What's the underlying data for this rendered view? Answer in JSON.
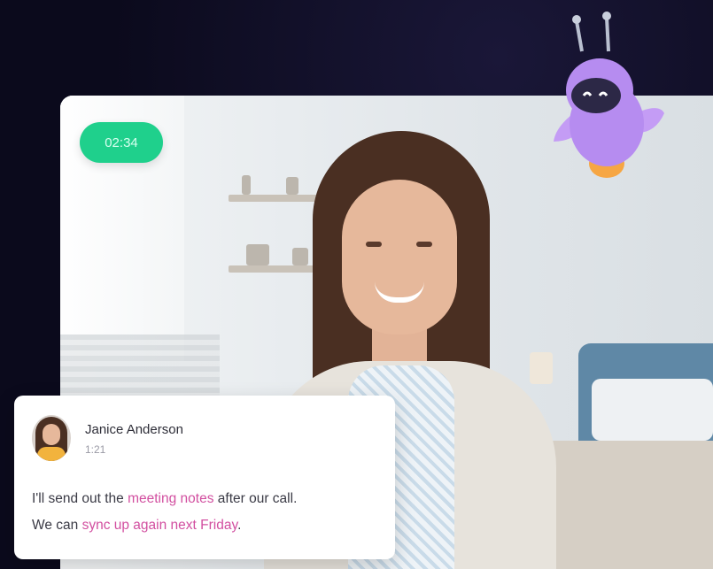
{
  "timer": {
    "label": "02:34"
  },
  "caption": {
    "speaker_name": "Janice Anderson",
    "timestamp": "1:21",
    "line1_part1": "I'll send out the ",
    "line1_highlight": "meeting notes",
    "line1_part2": " after our call.",
    "line2_part1": "We can ",
    "line2_highlight": "sync up again next Friday",
    "line2_part2": "."
  },
  "colors": {
    "background": "#0b0a1c",
    "timer_green": "#1fd08c",
    "highlight_pink": "#d24fa0",
    "robot_purple": "#b68cf0"
  },
  "icons": {
    "mascot": "robot-mascot-icon"
  }
}
